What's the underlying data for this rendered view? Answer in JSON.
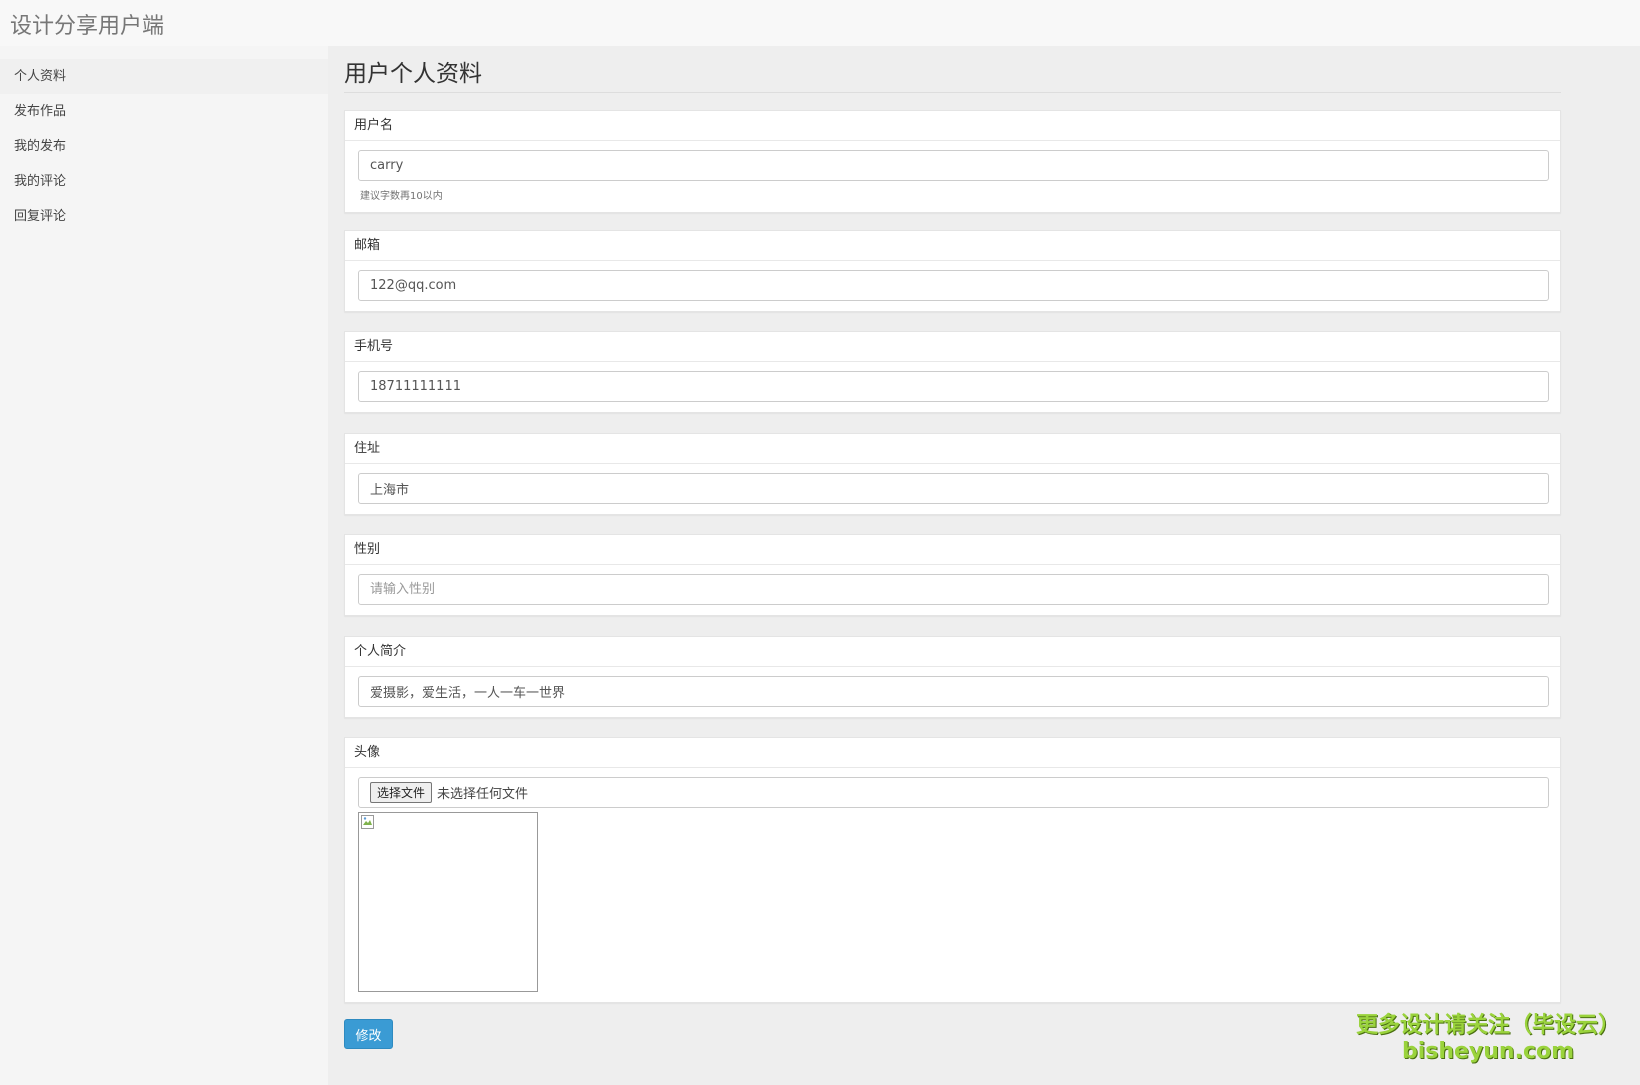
{
  "app": {
    "title": "设计分享用户端"
  },
  "sidebar": {
    "items": [
      {
        "label": "个人资料"
      },
      {
        "label": "发布作品"
      },
      {
        "label": "我的发布"
      },
      {
        "label": "我的评论"
      },
      {
        "label": "回复评论"
      }
    ]
  },
  "page": {
    "title": "用户个人资料"
  },
  "form": {
    "username": {
      "label": "用户名",
      "value": "carry",
      "help": "建议字数再10以内"
    },
    "email": {
      "label": "邮箱",
      "value": "122@qq.com"
    },
    "phone": {
      "label": "手机号",
      "value": "18711111111"
    },
    "address": {
      "label": "住址",
      "value": "上海市"
    },
    "gender": {
      "label": "性别",
      "value": "",
      "placeholder": "请输入性别"
    },
    "bio": {
      "label": "个人简介",
      "value": "爱摄影，爱生活，一人一车一世界"
    },
    "avatar": {
      "label": "头像",
      "button": "选择文件",
      "status": "未选择任何文件"
    },
    "submit_label": "修改"
  },
  "watermark": {
    "line1": "更多设计请关注（毕设云）",
    "line2": "bisheyun.com"
  },
  "colors": {
    "primary_button": "#3a9bd4",
    "watermark": "#9ad33c"
  }
}
